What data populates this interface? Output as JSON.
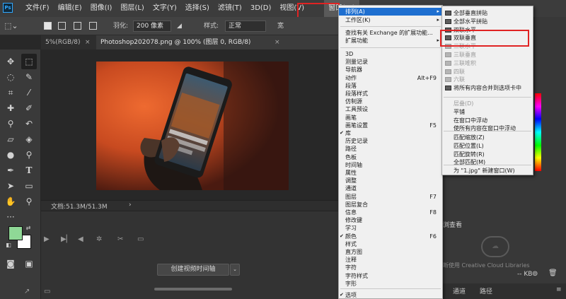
{
  "app": {
    "logo": "Ps"
  },
  "menubar": {
    "items": [
      "文件(F)",
      "编辑(E)",
      "图像(I)",
      "图层(L)",
      "文字(Y)",
      "选择(S)",
      "滤镜(T)",
      "3D(D)",
      "视图(V)",
      "窗口(W)"
    ]
  },
  "options": {
    "feather_label": "羽化:",
    "feather_value": "200 像素",
    "style_label": "样式:",
    "style_value": "正常"
  },
  "tabs": [
    {
      "label": "5%(RGB/8)",
      "close": "×"
    },
    {
      "label": "Photoshop202078.png @ 100% (图层 0, RGB/8)",
      "close": "×"
    }
  ],
  "status": {
    "doc_info": "文档:51.3M/51.3M",
    "arrow": "›"
  },
  "timeline": {
    "create_video": "创建视频时间轴"
  },
  "window_menu": {
    "arrange": "排列(A)",
    "workspace": "工作区(K)",
    "find_exchange": "查找有关 Exchange 的扩展功能...",
    "extensions": "扩展功能",
    "items": [
      {
        "label": "3D",
        "shortcut": "",
        "checked": false
      },
      {
        "label": "测量记录",
        "shortcut": "",
        "checked": false
      },
      {
        "label": "导航器",
        "shortcut": "",
        "checked": false
      },
      {
        "label": "动作",
        "shortcut": "Alt+F9",
        "checked": false
      },
      {
        "label": "段落",
        "shortcut": "",
        "checked": false
      },
      {
        "label": "段落样式",
        "shortcut": "",
        "checked": false
      },
      {
        "label": "仿制源",
        "shortcut": "",
        "checked": false
      },
      {
        "label": "工具预设",
        "shortcut": "",
        "checked": false
      },
      {
        "label": "画笔",
        "shortcut": "",
        "checked": false
      },
      {
        "label": "画笔设置",
        "shortcut": "F5",
        "checked": false
      },
      {
        "label": "库",
        "shortcut": "",
        "checked": true
      },
      {
        "label": "历史记录",
        "shortcut": "",
        "checked": false
      },
      {
        "label": "路径",
        "shortcut": "",
        "checked": false
      },
      {
        "label": "色板",
        "shortcut": "",
        "checked": false
      },
      {
        "label": "时间轴",
        "shortcut": "",
        "checked": false
      },
      {
        "label": "属性",
        "shortcut": "",
        "checked": false
      },
      {
        "label": "调整",
        "shortcut": "",
        "checked": false
      },
      {
        "label": "通道",
        "shortcut": "",
        "checked": false
      },
      {
        "label": "图层",
        "shortcut": "F7",
        "checked": false
      },
      {
        "label": "图层复合",
        "shortcut": "",
        "checked": false
      },
      {
        "label": "信息",
        "shortcut": "F8",
        "checked": false
      },
      {
        "label": "修改键",
        "shortcut": "",
        "checked": false
      },
      {
        "label": "学习",
        "shortcut": "",
        "checked": false
      },
      {
        "label": "颜色",
        "shortcut": "F6",
        "checked": true
      },
      {
        "label": "样式",
        "shortcut": "",
        "checked": false
      },
      {
        "label": "直方图",
        "shortcut": "",
        "checked": false
      },
      {
        "label": "注释",
        "shortcut": "",
        "checked": false
      },
      {
        "label": "字符",
        "shortcut": "",
        "checked": false
      },
      {
        "label": "字符样式",
        "shortcut": "",
        "checked": false
      },
      {
        "label": "字形",
        "shortcut": "",
        "checked": false
      }
    ],
    "options_item": {
      "label": "选项",
      "checked": true
    }
  },
  "arrange_menu": {
    "group1": [
      {
        "label": "全部垂直拼贴",
        "disabled": false
      },
      {
        "label": "全部水平拼贴",
        "disabled": false
      },
      {
        "label": "双联水平",
        "disabled": false
      },
      {
        "label": "双联垂直",
        "disabled": false
      },
      {
        "label": "三联水平",
        "disabled": true
      },
      {
        "label": "三联垂直",
        "disabled": true
      },
      {
        "label": "三联堆积",
        "disabled": true
      },
      {
        "label": "四联",
        "disabled": true
      },
      {
        "label": "六联",
        "disabled": true
      },
      {
        "label": "将所有内容合并到选项卡中",
        "disabled": false
      }
    ],
    "group2": [
      {
        "label": "层叠(D)",
        "disabled": true
      },
      {
        "label": "平铺",
        "disabled": false
      },
      {
        "label": "在窗口中浮动",
        "disabled": false
      },
      {
        "label": "使所有内容在窗口中浮动",
        "disabled": false
      }
    ],
    "group3": [
      {
        "label": "匹配缩放(Z)",
        "disabled": false
      },
      {
        "label": "匹配位置(L)",
        "disabled": false
      },
      {
        "label": "匹配旋转(R)",
        "disabled": false
      },
      {
        "label": "全部匹配(M)",
        "disabled": false
      }
    ],
    "new_window": "为 \"1.jpg\" 新建窗口(W)"
  },
  "right_panel": {
    "view_label": "浏查看",
    "cc_text": "断使用 Creative Cloud Libraries",
    "kb_label": "-- KB",
    "tabs": [
      "通道",
      "路径"
    ]
  },
  "colors": {
    "foreground": "#8fd896",
    "background": "#ffffff",
    "highlight": "#e02323",
    "menu_selection": "#1e6fd0"
  }
}
